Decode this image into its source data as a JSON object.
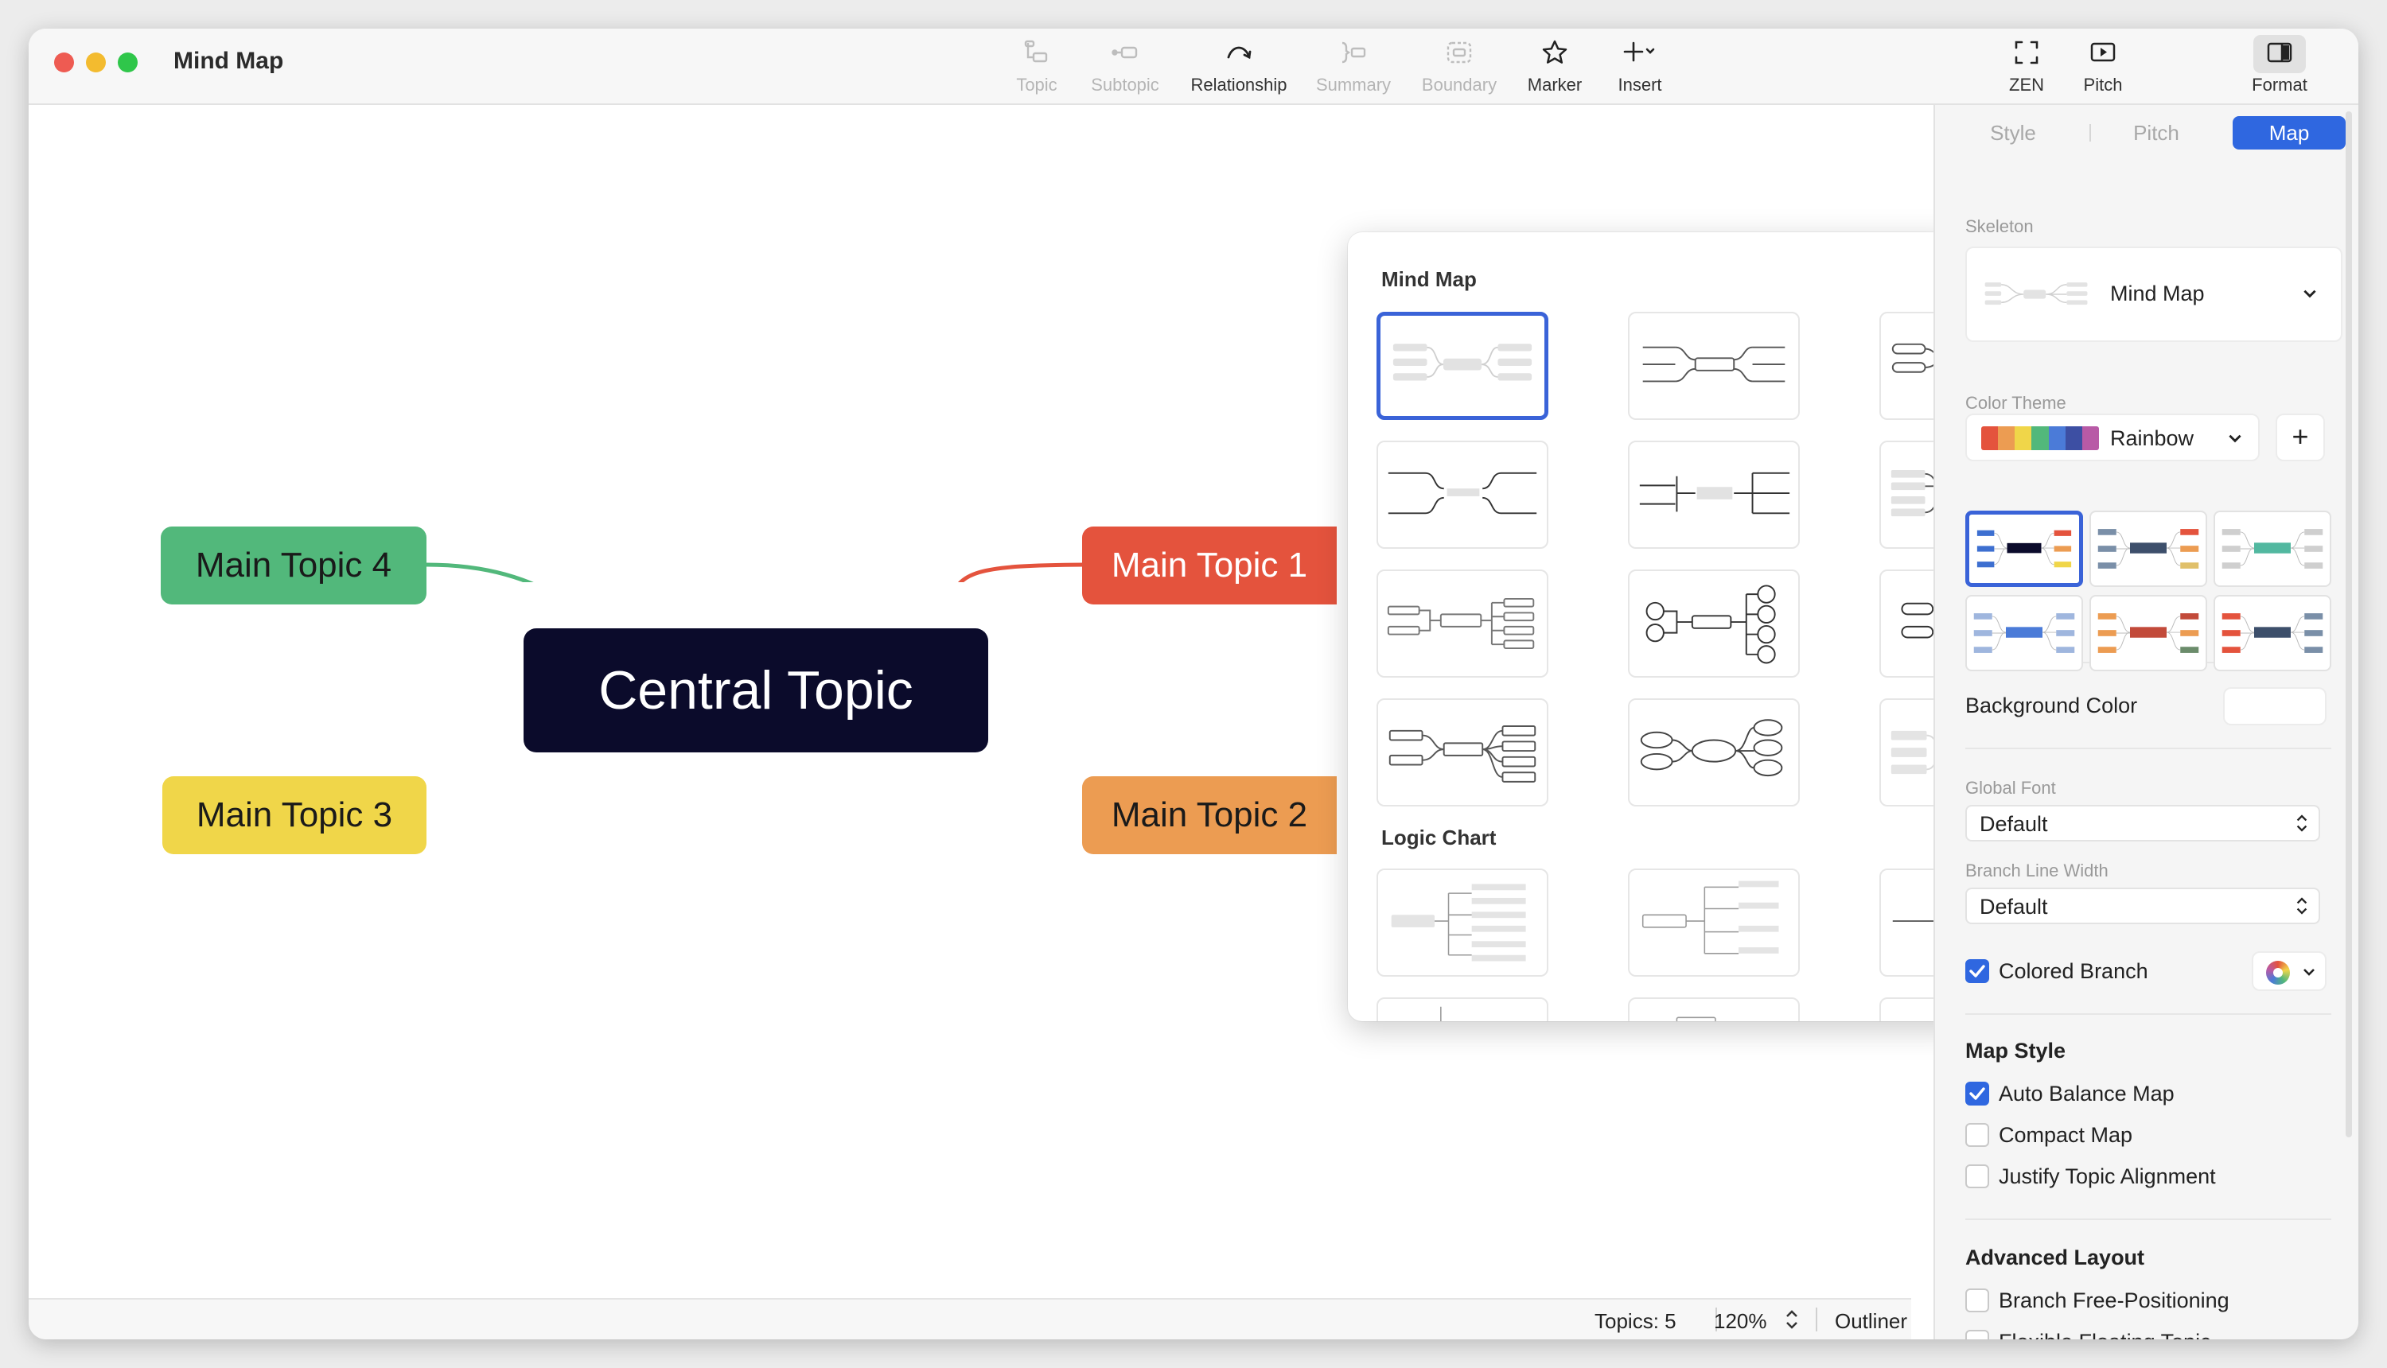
{
  "window": {
    "title": "Mind Map",
    "traffic_lights": {
      "close": "#ee5b52",
      "minimize": "#f3bb2f",
      "zoom": "#2fc64a"
    }
  },
  "toolbar": {
    "topic": "Topic",
    "subtopic": "Subtopic",
    "relationship": "Relationship",
    "summary": "Summary",
    "boundary": "Boundary",
    "marker": "Marker",
    "insert": "Insert",
    "zen": "ZEN",
    "pitch": "Pitch",
    "format": "Format"
  },
  "map": {
    "central": {
      "label": "Central Topic",
      "color": "#0b0b2b"
    },
    "topics": [
      {
        "label": "Main Topic 1",
        "color": "#e4533d",
        "text_color": "#ffffff"
      },
      {
        "label": "Main Topic 2",
        "color": "#ec9c52",
        "text_color": "#1a1a1a"
      },
      {
        "label": "Main Topic 3",
        "color": "#f0d649",
        "text_color": "#1a1a1a"
      },
      {
        "label": "Main Topic 4",
        "color": "#52b87b",
        "text_color": "#1a1a1a"
      }
    ]
  },
  "statusbar": {
    "topics": "Topics: 5",
    "zoom": "120%",
    "outliner": "Outliner"
  },
  "skeleton_popover": {
    "sections": [
      {
        "title": "Mind Map",
        "selected_index": 0,
        "locked": [
          5,
          9,
          10,
          11
        ]
      },
      {
        "title": "Logic Chart"
      }
    ]
  },
  "format_panel": {
    "tabs": [
      "Style",
      "Pitch",
      "Map"
    ],
    "active_tab": "Map",
    "accent": "#2f67e0",
    "skeleton": {
      "label": "Skeleton",
      "value": "Mind Map"
    },
    "color_theme": {
      "label": "Color Theme",
      "value": "Rainbow",
      "swatches": [
        "#e4533d",
        "#ec9c52",
        "#f0d649",
        "#52b87b",
        "#4b7bd8",
        "#3d4fa3",
        "#b85aa6"
      ],
      "add": "+"
    },
    "background_color": {
      "label": "Background Color"
    },
    "global_font": {
      "label": "Global Font",
      "value": "Default"
    },
    "branch_line_width": {
      "label": "Branch Line Width",
      "value": "Default"
    },
    "colored_branch": {
      "label": "Colored Branch",
      "checked": true
    },
    "map_style": {
      "title": "Map Style",
      "options": [
        {
          "label": "Auto Balance Map",
          "checked": true
        },
        {
          "label": "Compact Map",
          "checked": false
        },
        {
          "label": "Justify Topic Alignment",
          "checked": false
        }
      ]
    },
    "advanced_layout": {
      "title": "Advanced Layout",
      "options": [
        {
          "label": "Branch Free-Positioning",
          "checked": false
        },
        {
          "label": "Flexible Floating Topic",
          "checked": false
        }
      ]
    }
  }
}
